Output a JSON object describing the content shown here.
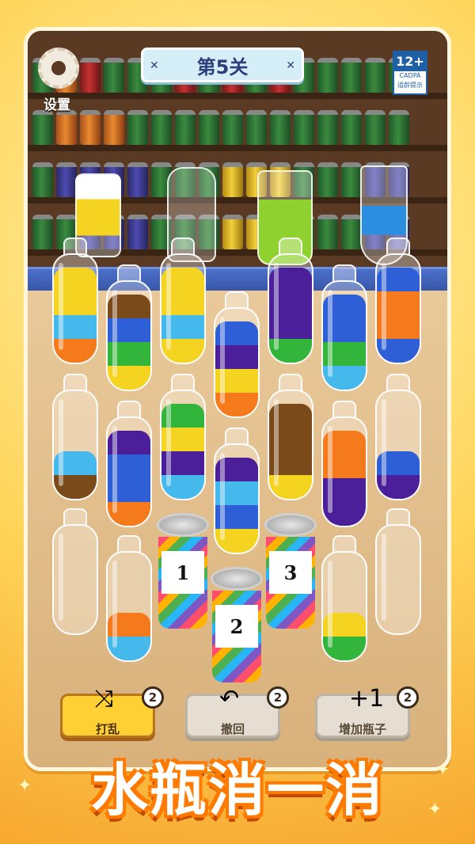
{
  "level": {
    "label": "第5关"
  },
  "settings": {
    "label": "设置"
  },
  "age_rating": {
    "number": "12+",
    "org": "CADPA",
    "tip": "适龄提示"
  },
  "colors": {
    "yellow": "#f5d321",
    "lightblue": "#45b9ec",
    "orange": "#f47a1c",
    "brown": "#7a4a1a",
    "blue": "#2f5fd6",
    "green": "#33b43a",
    "purple": "#4b1f9a",
    "darkblue": "#2045c8",
    "darkpurple": "#3b1a7a"
  },
  "bottles": [
    {
      "layers": [
        "orange",
        "lightblue",
        "yellow",
        "yellow"
      ]
    },
    {
      "layers": [
        "yellow",
        "green",
        "blue",
        "brown"
      ]
    },
    {
      "layers": [
        "yellow",
        "lightblue",
        "yellow",
        "yellow"
      ]
    },
    {
      "layers": [
        "orange",
        "yellow",
        "purple",
        "blue"
      ]
    },
    {
      "layers": [
        "green",
        "purple",
        "purple",
        "purple"
      ]
    },
    {
      "layers": [
        "lightblue",
        "green",
        "blue",
        "blue"
      ]
    },
    {
      "layers": [
        "blue",
        "orange",
        "orange",
        "blue"
      ]
    },
    {
      "layers": [
        "brown",
        "lightblue"
      ]
    },
    {
      "layers": [
        "orange",
        "blue",
        "blue",
        "purple"
      ]
    },
    {
      "layers": [
        "lightblue",
        "purple",
        "yellow",
        "green"
      ]
    },
    {
      "layers": [
        "yellow",
        "blue",
        "lightblue",
        "purple"
      ]
    },
    {
      "layers": [
        "yellow",
        "brown",
        "brown",
        "brown"
      ]
    },
    {
      "layers": [
        "purple",
        "purple",
        "orange",
        "orange"
      ]
    },
    {
      "layers": [
        "purple",
        "blue"
      ]
    },
    {
      "layers": []
    },
    {
      "layers": [
        "lightblue",
        "orange"
      ]
    },
    {
      "layers": [
        "green",
        "yellow"
      ]
    },
    {
      "layers": []
    }
  ],
  "cans": [
    {
      "label": "1"
    },
    {
      "label": "2"
    },
    {
      "label": "3"
    }
  ],
  "powerups": [
    {
      "label": "打乱",
      "count": "2",
      "icon": "shuffle-icon",
      "glyph": "⤨"
    },
    {
      "label": "撤回",
      "count": "2",
      "icon": "undo-icon",
      "glyph": "↶"
    },
    {
      "label": "增加瓶子",
      "count": "2",
      "icon": "add-bottle-icon",
      "glyph": "+1"
    }
  ],
  "title": "水瓶消一消"
}
